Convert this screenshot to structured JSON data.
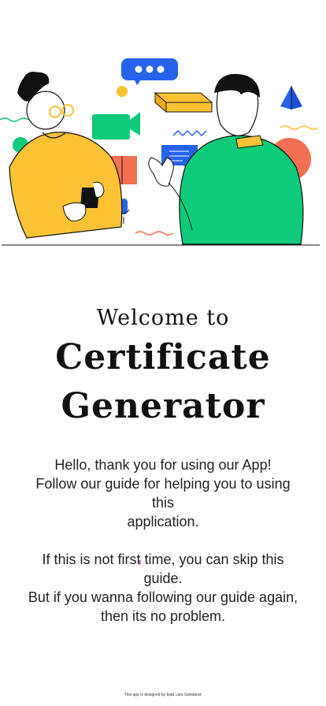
{
  "onboarding": {
    "welcome": "Welcome to",
    "title_line1": "Certificate",
    "title_line2": "Generator",
    "intro_line1": "Hello, thank you for using our App!",
    "intro_line2": "Follow our guide for helping you to using this",
    "intro_line3": "application.",
    "intro_line4": "If this is not first time, you can skip this guide.",
    "intro_line5": "But if you wanna following our guide again,",
    "intro_line6": "then its no problem.",
    "footer": "This app is designed by Ipad Lara Gandaran"
  },
  "colors": {
    "yellow": "#FBC233",
    "green": "#0ECB7A",
    "blue": "#2563EB",
    "coral": "#F47053",
    "text": "#111111"
  },
  "icons": [
    "chat-bubble-icon",
    "video-camera-icon",
    "microphone-icon",
    "pyramid-icon",
    "message-icon"
  ]
}
